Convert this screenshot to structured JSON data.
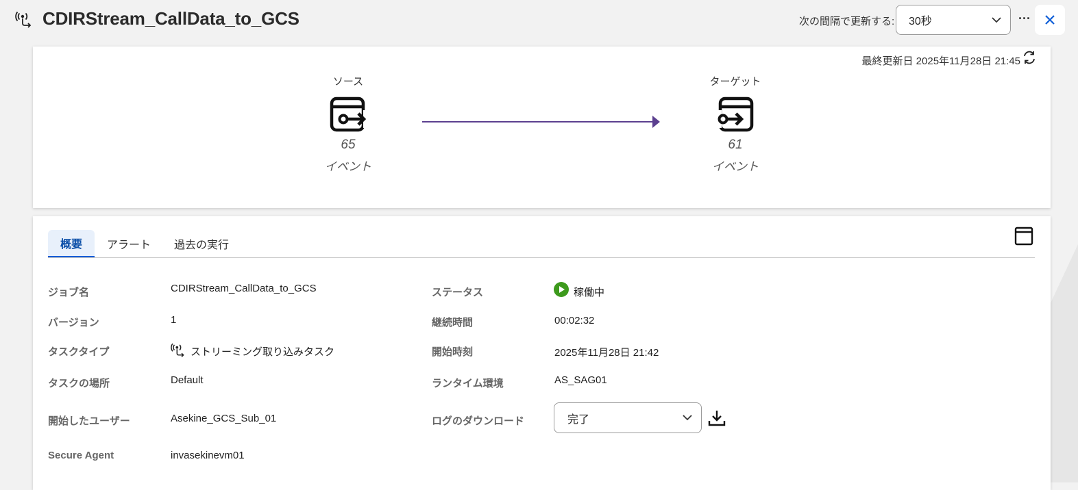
{
  "header": {
    "title": "CDIRStream_CallData_to_GCS",
    "refresh_label": "次の間隔で更新する:",
    "refresh_value": "30秒",
    "more_label": "···"
  },
  "flow": {
    "last_updated": "最終更新日 2025年11月28日 21:45",
    "source": {
      "label": "ソース",
      "count": "65",
      "unit": "イベント"
    },
    "target": {
      "label": "ターゲット",
      "count": "61",
      "unit": "イベント"
    }
  },
  "tabs": [
    "概要",
    "アラート",
    "過去の実行"
  ],
  "details": {
    "left": [
      {
        "label": "ジョブ名",
        "value": "CDIRStream_CallData_to_GCS"
      },
      {
        "label": "バージョン",
        "value": "1"
      },
      {
        "label": "タスクタイプ",
        "value": "ストリーミング取り込みタスク"
      },
      {
        "label": "タスクの場所",
        "value": "Default"
      },
      {
        "label": "開始したユーザー",
        "value": "Asekine_GCS_Sub_01"
      },
      {
        "label": "Secure Agent",
        "value": "invasekinevm01"
      }
    ],
    "right": [
      {
        "label": "ステータス",
        "value": "稼働中"
      },
      {
        "label": "継続時間",
        "value": "00:02:32"
      },
      {
        "label": "開始時刻",
        "value": "2025年11月28日 21:42"
      },
      {
        "label": "ランタイム環境",
        "value": "AS_SAG01"
      },
      {
        "label": "ログのダウンロード",
        "value": "完了"
      }
    ]
  },
  "colors": {
    "accent": "#0b5cd7",
    "arrow": "#5b3f8f",
    "status_running": "#3d9a1d"
  },
  "icons": {
    "job": "streaming-ingestion-icon",
    "refresh": "refresh-icon",
    "close": "close-icon",
    "expand": "window-icon",
    "download": "download-icon"
  }
}
